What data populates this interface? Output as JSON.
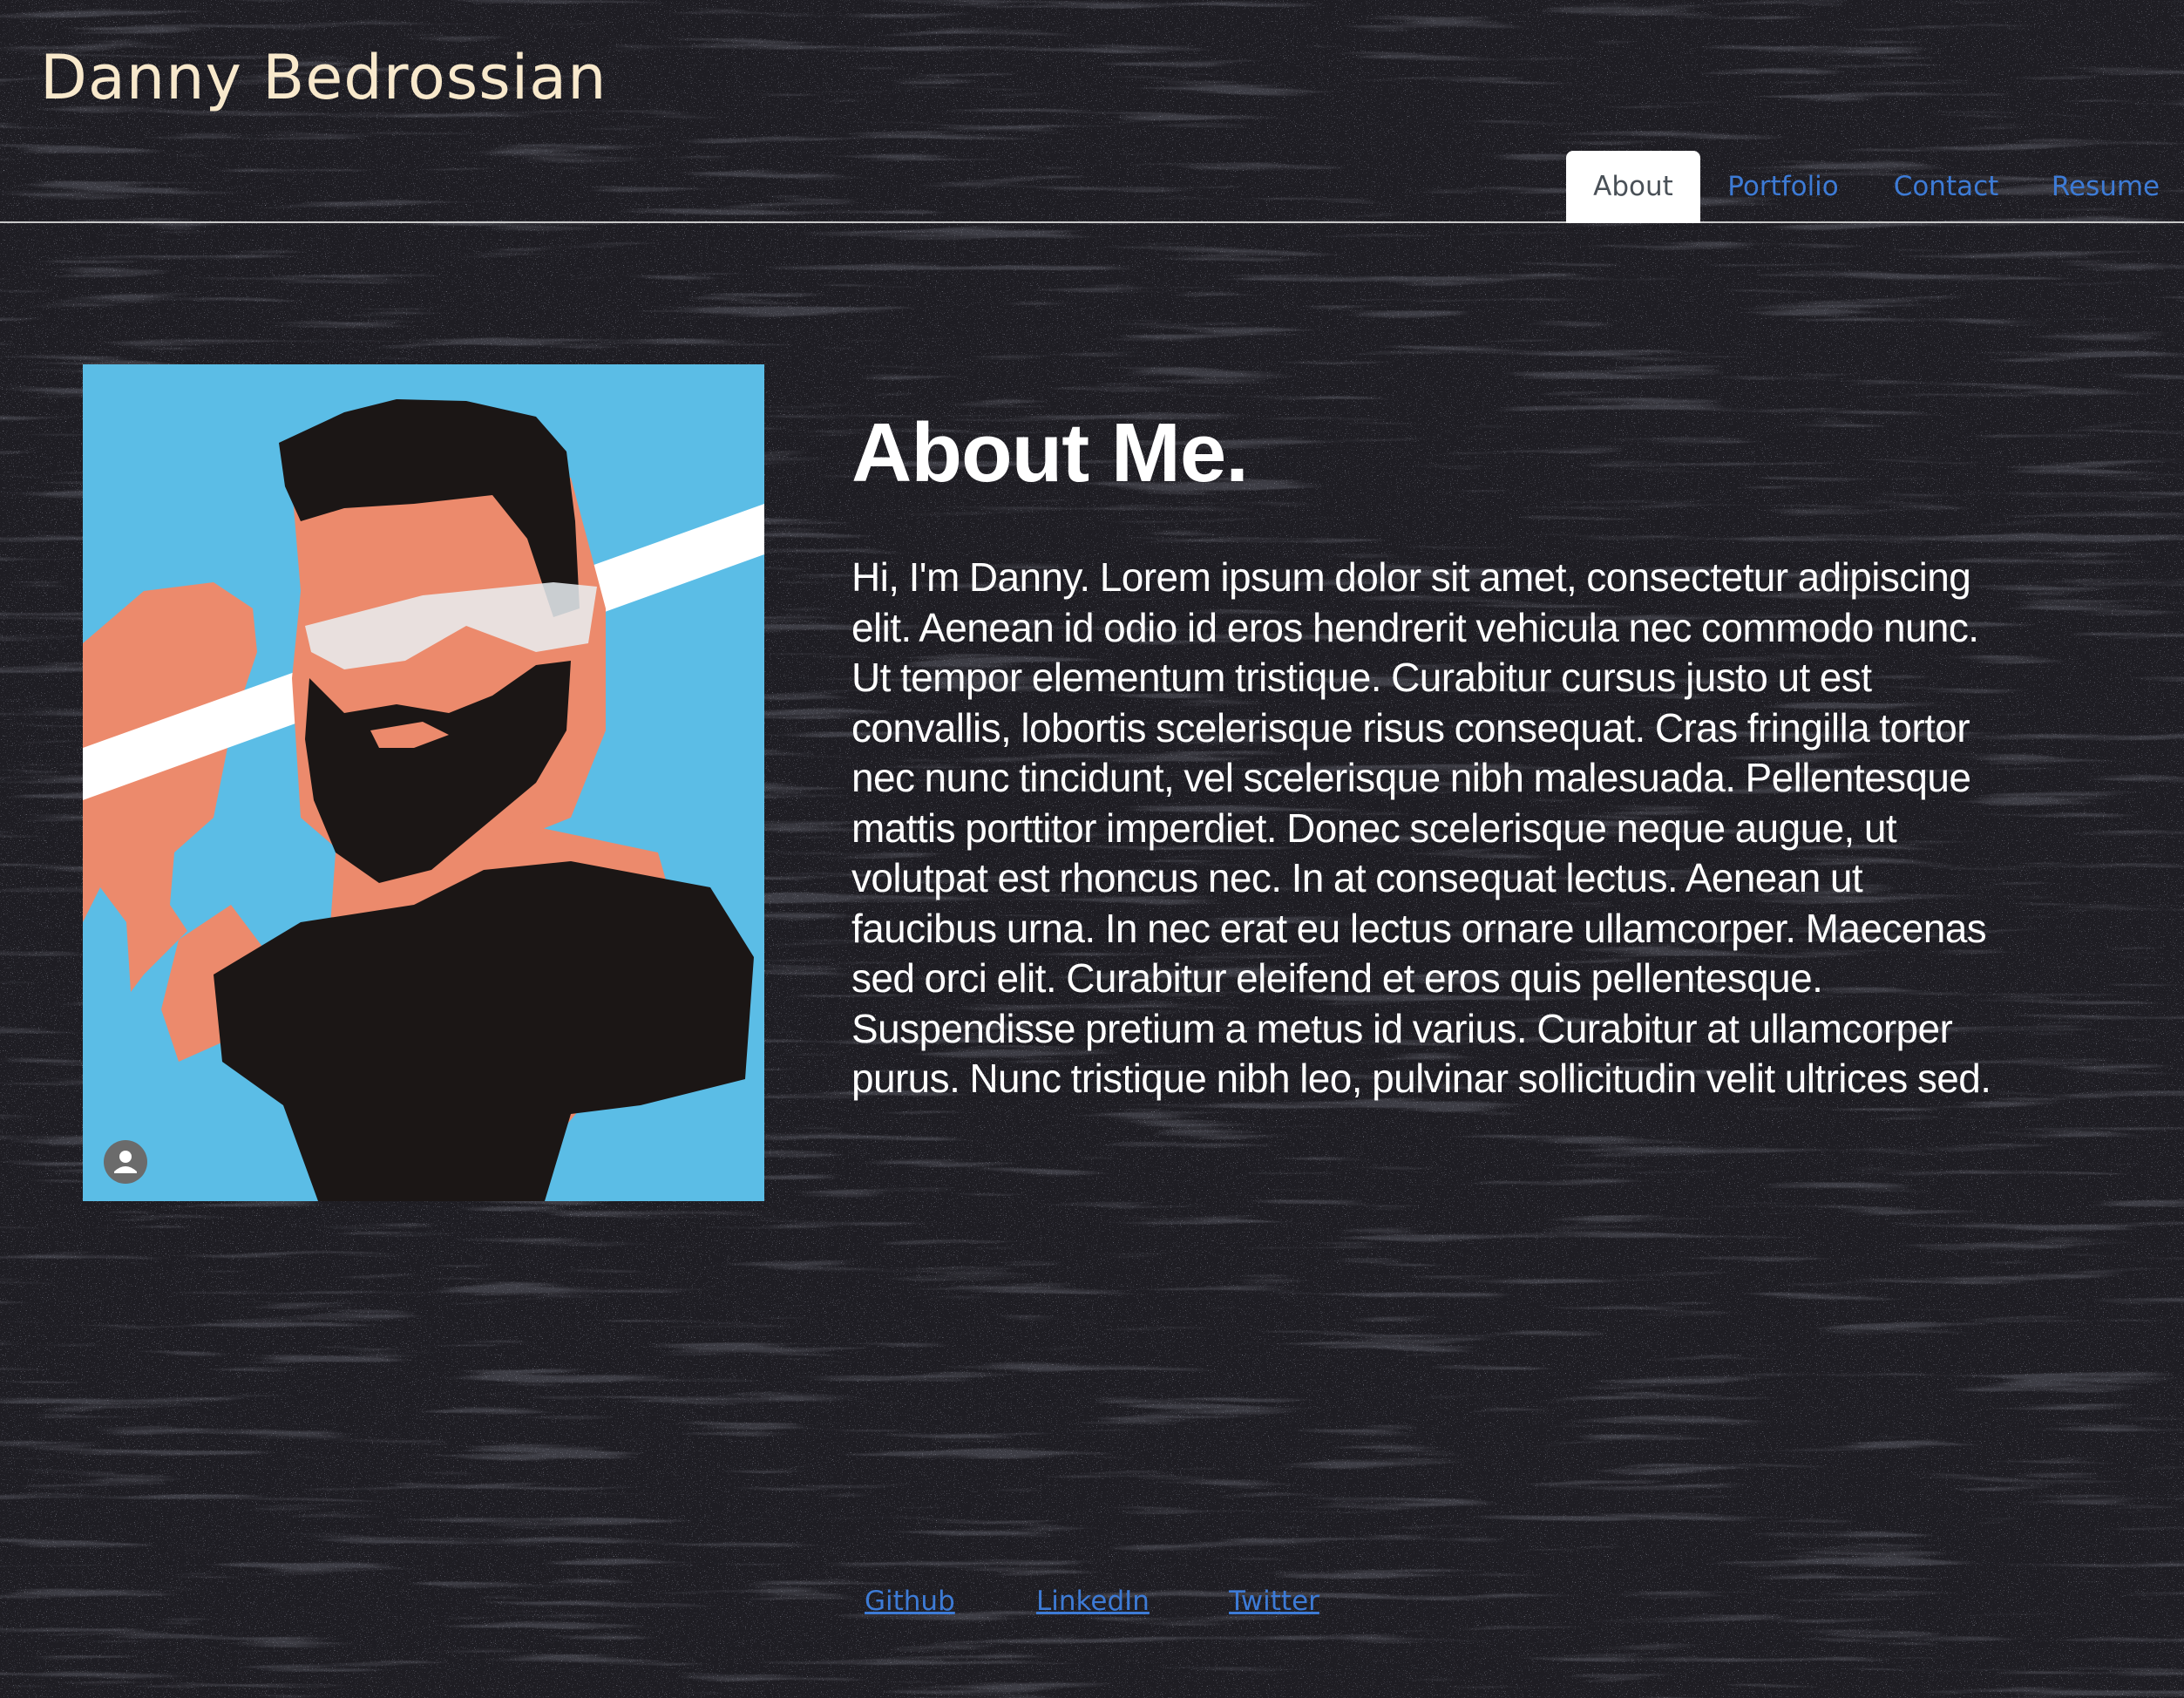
{
  "site": {
    "title": "Danny Bedrossian"
  },
  "nav": {
    "tabs": [
      {
        "label": "About",
        "active": true
      },
      {
        "label": "Portfolio",
        "active": false
      },
      {
        "label": "Contact",
        "active": false
      },
      {
        "label": "Resume",
        "active": false
      }
    ]
  },
  "about": {
    "heading": "About Me.",
    "text": "Hi, I'm Danny. Lorem ipsum dolor sit amet, consectetur adipiscing elit. Aenean id odio id eros hendrerit vehicula nec commodo nunc. Ut tempor elementum tristique. Curabitur cursus justo ut est convallis, lobortis scelerisque risus consequat. Cras fringilla tortor nec nunc tincidunt, vel scelerisque nibh malesuada. Pellentesque mattis porttitor imperdiet. Donec scelerisque neque augue, ut volutpat est rhoncus nec. In at consequat lectus. Aenean ut faucibus urna. In nec erat eu lectus ornare ullamcorper. Maecenas sed orci elit. Curabitur eleifend et eros quis pellentesque. Suspendisse pretium a metus id varius. Curabitur at ullamcorper purus. Nunc tristique nibh leo, pulvinar sollicitudin velit ultrices sed."
  },
  "portrait": {
    "icon": "person-icon"
  },
  "footer": {
    "links": [
      {
        "label": "Github"
      },
      {
        "label": "LinkedIn"
      },
      {
        "label": "Twitter"
      }
    ]
  },
  "colors": {
    "background": "#1e1d23",
    "title": "#f8e9cc",
    "link": "#3d7bd6",
    "active_tab_bg": "#ffffff",
    "active_tab_text": "#495057",
    "text": "#ffffff"
  }
}
